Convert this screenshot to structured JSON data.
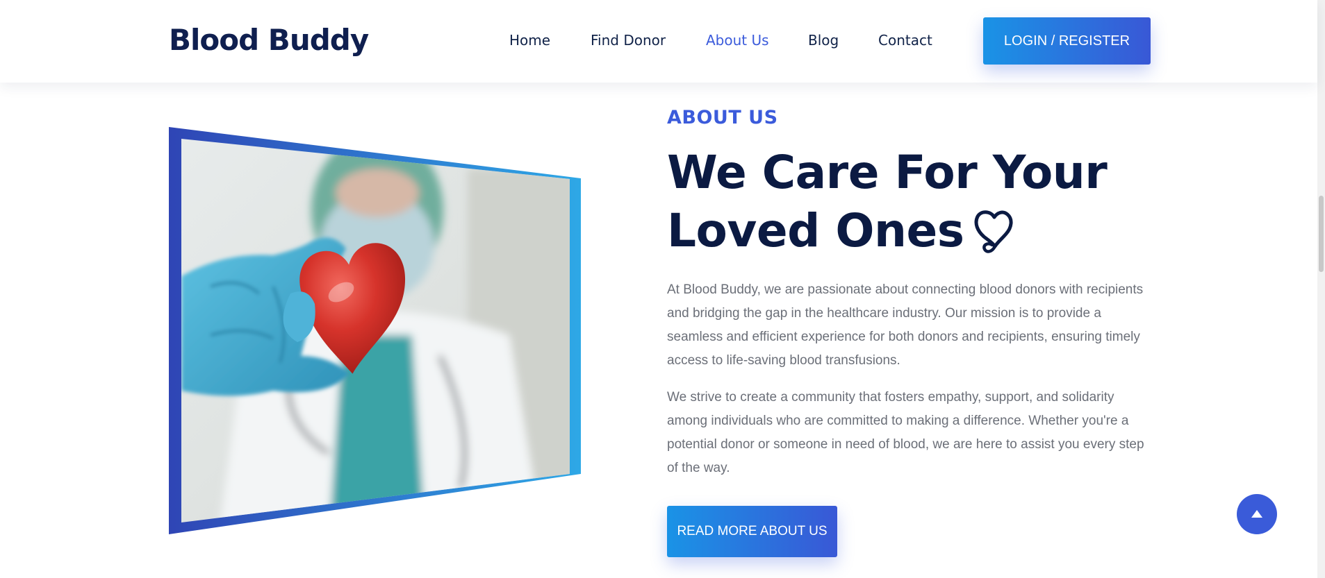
{
  "header": {
    "logo": "Blood Buddy",
    "nav": [
      {
        "label": "Home"
      },
      {
        "label": "Find Donor"
      },
      {
        "label": "About Us"
      },
      {
        "label": "Blog"
      },
      {
        "label": "Contact"
      }
    ],
    "active_nav": "About Us",
    "login_label": "LOGIN / REGISTER"
  },
  "about": {
    "eyebrow": "ABOUT US",
    "headline_line1": "We Care For Your",
    "headline_line2": "Loved Ones",
    "headline_icon": "stethoscope-heart-icon",
    "paragraph1": "At Blood Buddy, we are passionate about connecting blood donors with recipients and bridging the gap in the healthcare industry. Our mission is to provide a seamless and efficient experience for both donors and recipients, ensuring timely access to life-saving blood transfusions.",
    "paragraph2": "We strive to create a community that fosters empathy, support, and solidarity among individuals who are committed to making a difference. Whether you're a potential donor or someone in need of blood, we are here to assist you every step of the way.",
    "cta_label": "READ MORE ABOUT US",
    "image_icon": "doctor-holding-heart-photo"
  },
  "controls": {
    "back_to_top_icon": "arrow-up-icon"
  },
  "colors": {
    "brand_navy": "#0b1a42",
    "accent_blue": "#3b5bdb",
    "gradient_start": "#1a93e6",
    "gradient_end": "#3958d6",
    "body_text": "#6b6f78"
  }
}
